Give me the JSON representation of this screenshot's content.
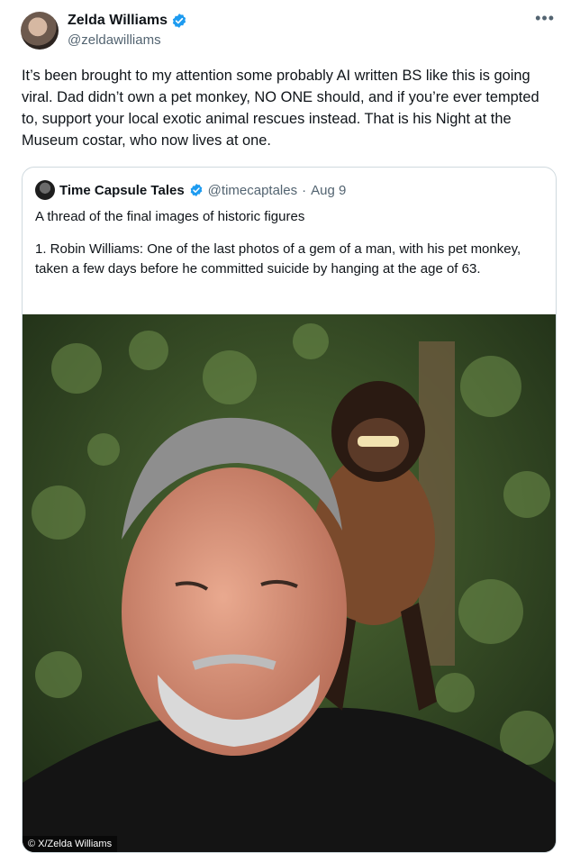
{
  "author": {
    "display_name": "Zelda Williams",
    "handle": "@zeldawilliams",
    "verified_color": "#1d9bf0"
  },
  "more_icon": "more-horizontal-icon",
  "tweet_text": "It’s been brought to my attention some probably AI written BS like this is going viral. Dad didn’t own a pet monkey, NO ONE should, and if you’re ever tempted to, support your local exotic animal rescues instead. That is his Night at the Museum costar, who now lives at one.",
  "quoted": {
    "display_name": "Time Capsule Tales",
    "handle": "@timecaptales",
    "separator": "·",
    "date": "Aug 9",
    "line1": "A thread of the final images of historic figures",
    "line2": "1. Robin Williams: One of the last photos of a gem of a man, with his pet monkey, taken a few days before he committed suicide by hanging at the age of 63."
  },
  "photo_credit": "© X/Zelda Williams",
  "colors": {
    "text": "#0f1419",
    "muted": "#536471",
    "border": "#cfd9de",
    "verified": "#1d9bf0"
  }
}
